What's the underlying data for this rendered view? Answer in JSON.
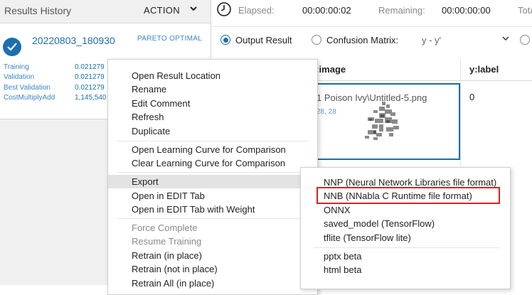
{
  "left_panel": {
    "title": "Results History",
    "action_label": "ACTION",
    "result": {
      "name": "20220803_180930",
      "badge": "PARETO OPTIMAL",
      "metrics": [
        {
          "label": "Training",
          "value": "0.021279"
        },
        {
          "label": "Validation",
          "value": "0.021279"
        },
        {
          "label": "Best Validation",
          "value": "0.021279"
        },
        {
          "label": "CostMultiplyAdd",
          "value": "1,145,540"
        }
      ]
    }
  },
  "status": {
    "elapsed_label": "Elapsed:",
    "elapsed_value": "00:00:00:02",
    "remaining_label": "Remaining:",
    "remaining_value": "00:00:00:00",
    "total_label": "Tota"
  },
  "options": {
    "output_result": "Output Result",
    "confusion_matrix": "Confusion Matrix:",
    "confusion_select": "y - y'"
  },
  "table": {
    "columns": [
      "x:image",
      "y:label"
    ],
    "row": {
      "image_path": "1 Poison Ivy\\Untitled-5.png",
      "image_dims": "28, 28",
      "label": "0"
    }
  },
  "context_menu": {
    "items": [
      {
        "label": "Open Result Location",
        "enabled": true
      },
      {
        "label": "Rename",
        "enabled": true
      },
      {
        "label": "Edit Comment",
        "enabled": true
      },
      {
        "label": "Refresh",
        "enabled": true
      },
      {
        "label": "Duplicate",
        "enabled": true
      },
      {
        "label": "Open Learning Curve for Comparison",
        "enabled": true
      },
      {
        "label": "Clear Learning Curve for Comparison",
        "enabled": true
      },
      {
        "label": "Export",
        "enabled": true
      },
      {
        "label": "Open in EDIT Tab",
        "enabled": true
      },
      {
        "label": "Open in EDIT Tab with Weight",
        "enabled": true
      },
      {
        "label": "Force Complete",
        "enabled": false
      },
      {
        "label": "Resume Training",
        "enabled": false
      },
      {
        "label": "Retrain (in place)",
        "enabled": true
      },
      {
        "label": "Retrain (not in place)",
        "enabled": true
      },
      {
        "label": "Retrain All (in place)",
        "enabled": true
      }
    ]
  },
  "export_submenu": {
    "items": [
      {
        "label": "NNP (Neural Network Libraries file format)"
      },
      {
        "label": "NNB (NNabla C Runtime file format)"
      },
      {
        "label": "ONNX"
      },
      {
        "label": "saved_model (TensorFlow)"
      },
      {
        "label": "tflite (TensorFlow lite)"
      },
      {
        "label": "pptx beta"
      },
      {
        "label": "html beta"
      }
    ]
  },
  "colors": {
    "accent": "#1c6fad",
    "highlight_border": "#e02020",
    "active_menu": "#e3e3e3"
  },
  "icons": [
    "check-circle-icon",
    "chevron-down-icon",
    "clock-icon",
    "radio-icon"
  ]
}
